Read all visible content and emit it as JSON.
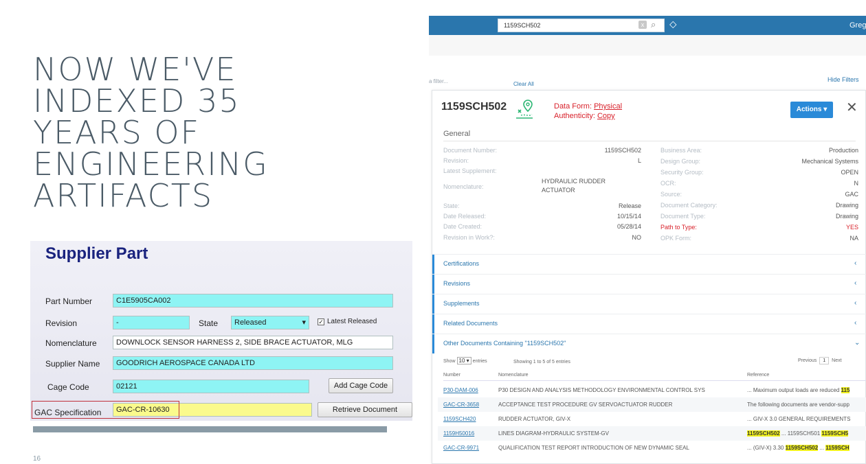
{
  "slide": {
    "title_lines": [
      "NOW WE'VE",
      "INDEXED 35",
      "YEARS OF",
      "ENGINEERING",
      "ARTIFACTS"
    ],
    "page_number": "16"
  },
  "supplier_form": {
    "heading": "Supplier Part",
    "part_number": {
      "label": "Part Number",
      "value": "C1E5905CA002"
    },
    "revision": {
      "label": "Revision",
      "value": "-"
    },
    "state": {
      "label": "State",
      "value": "Released"
    },
    "latest_released": {
      "label": "Latest Released",
      "checked": true,
      "check_glyph": "✓"
    },
    "nomenclature": {
      "label": "Nomenclature",
      "value": "DOWNLOCK SENSOR HARNESS 2, SIDE BRACE ACTUATOR, MLG"
    },
    "supplier_name": {
      "label": "Supplier Name",
      "value": "GOODRICH AEROSPACE CANADA LTD"
    },
    "cage_code": {
      "label": "Cage Code",
      "value": "02121"
    },
    "add_cage_button": "Add Cage Code",
    "gac_spec": {
      "label": "GAC Specification",
      "value": "GAC-CR-10630"
    },
    "retrieve_button": "Retrieve Document",
    "dropdown_glyph": "▾"
  },
  "app": {
    "search": {
      "value": "1159SCH502",
      "clear_glyph": "x",
      "search_glyph": "⌕"
    },
    "tag_glyph": "⬦",
    "user_name": "Greg",
    "filter_placeholder": "a filter...",
    "clear_all": "Clear All",
    "hide_filters": "Hide Filters",
    "colors": {
      "topbar": "#2a76ad",
      "accent": "#2a8ad8",
      "highlight": "#f2f21c",
      "alert": "#d8202a"
    },
    "card": {
      "title": "1159SCH502",
      "data_form_label": "Data Form:",
      "data_form_value": "Physical",
      "authenticity_label": "Authenticity:",
      "authenticity_value": "Copy",
      "actions_label": "Actions ▾",
      "close_glyph": "✕",
      "section_title": "General",
      "left_fields": [
        {
          "key": "Document Number:",
          "value": "1159SCH502"
        },
        {
          "key": "Revision:",
          "value": "L"
        },
        {
          "key": "Latest Supplement:",
          "value": ""
        },
        {
          "key": "Nomenclature:",
          "value": "HYDRAULIC RUDDER ACTUATOR"
        },
        {
          "key": "State:",
          "value": "Release"
        },
        {
          "key": "Date Released:",
          "value": "10/15/14"
        },
        {
          "key": "Date Created:",
          "value": "05/28/14"
        },
        {
          "key": "Revision in Work?:",
          "value": "NO"
        }
      ],
      "right_fields": [
        {
          "key": "Business Area:",
          "value": "Production"
        },
        {
          "key": "Design Group:",
          "value": "Mechanical Systems"
        },
        {
          "key": "Security Group:",
          "value": "OPEN"
        },
        {
          "key": "OCR:",
          "value": "N"
        },
        {
          "key": "Source:",
          "value": "GAC"
        },
        {
          "key": "Document Category:",
          "value": "Drawing"
        },
        {
          "key": "Document Type:",
          "value": "Drawing"
        },
        {
          "key": "Path to Type:",
          "value": "YES"
        },
        {
          "key": "OPK Form:",
          "value": "NA"
        }
      ],
      "sections": [
        "Certifications",
        "Revisions",
        "Supplements",
        "Related Documents",
        "Other Documents Containing \"1159SCH502\""
      ],
      "collapsed_glyph": "‹",
      "expanded_glyph": "⌄",
      "table_controls": {
        "show_label": "Show",
        "entries_value": "10",
        "entries_label": "entries",
        "showing_text": "Showing 1 to 5 of 5 entries",
        "previous": "Previous",
        "page": "1",
        "next": "Next"
      },
      "table": {
        "columns": [
          "Number",
          "Nomenclature",
          "Reference"
        ],
        "rows": [
          {
            "number": "P30-DAM-006",
            "nomenclature": "P30 DESIGN AND ANALYSIS METHODOLOGY ENVIRONMENTAL CONTROL SYS",
            "ref_pre": "... Maximum output loads are reduced ",
            "ref_hl": "115",
            "ref_post": ""
          },
          {
            "number": "GAC-CR-3658",
            "nomenclature": "ACCEPTANCE TEST PROCEDURE GV SERVOACTUATOR RUDDER",
            "ref_pre": "The following documents are vendor-supp",
            "ref_hl": "",
            "ref_post": ""
          },
          {
            "number": "1159SCH420",
            "nomenclature": "RUDDER ACTUATOR, GIV-X",
            "ref_pre": "... GIV-X 3.0 GENERAL REQUIREMENTS",
            "ref_hl": "",
            "ref_post": ""
          },
          {
            "number": "1159H50016",
            "nomenclature": "LINES DIAGRAM-HYDRAULIC SYSTEM-GV",
            "ref_pre": "",
            "ref_hl": "1159SCH502",
            "ref_post": " ... 1159SCH501 ",
            "ref_hl2": "1159SCH5"
          },
          {
            "number": "GAC-CR-9971",
            "nomenclature": "QUALIFICATION TEST REPORT INTRODUCTION OF NEW DYNAMIC SEAL",
            "ref_pre": "... (GIV-X) 3.30 ",
            "ref_hl": "1159SCH502",
            "ref_post": " ... ",
            "ref_hl2": "1159SCH"
          }
        ]
      }
    }
  }
}
